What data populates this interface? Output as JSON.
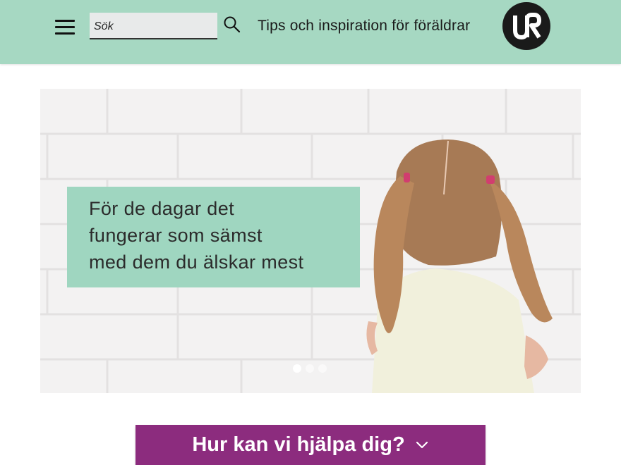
{
  "header": {
    "search": {
      "placeholder": "Sök",
      "value": ""
    },
    "tagline": "Tips och inspiration för föräldrar",
    "logo_text": "UR"
  },
  "hero": {
    "headline_lines": [
      "För de dagar det",
      "fungerar som sämst",
      "med dem du älskar mest"
    ],
    "slides_total": 3,
    "active_slide": 1
  },
  "help_button": {
    "label": "Hur kan vi hjälpa dig?"
  },
  "colors": {
    "header_bg": "#a6d8c2",
    "hero_box_bg": "#9fd6c0",
    "help_button_bg": "#8c2c7e",
    "logo_bg": "#1a1a1a"
  },
  "icons": {
    "menu": "hamburger-icon",
    "search": "search-icon",
    "dropdown": "chevron-down-icon"
  }
}
